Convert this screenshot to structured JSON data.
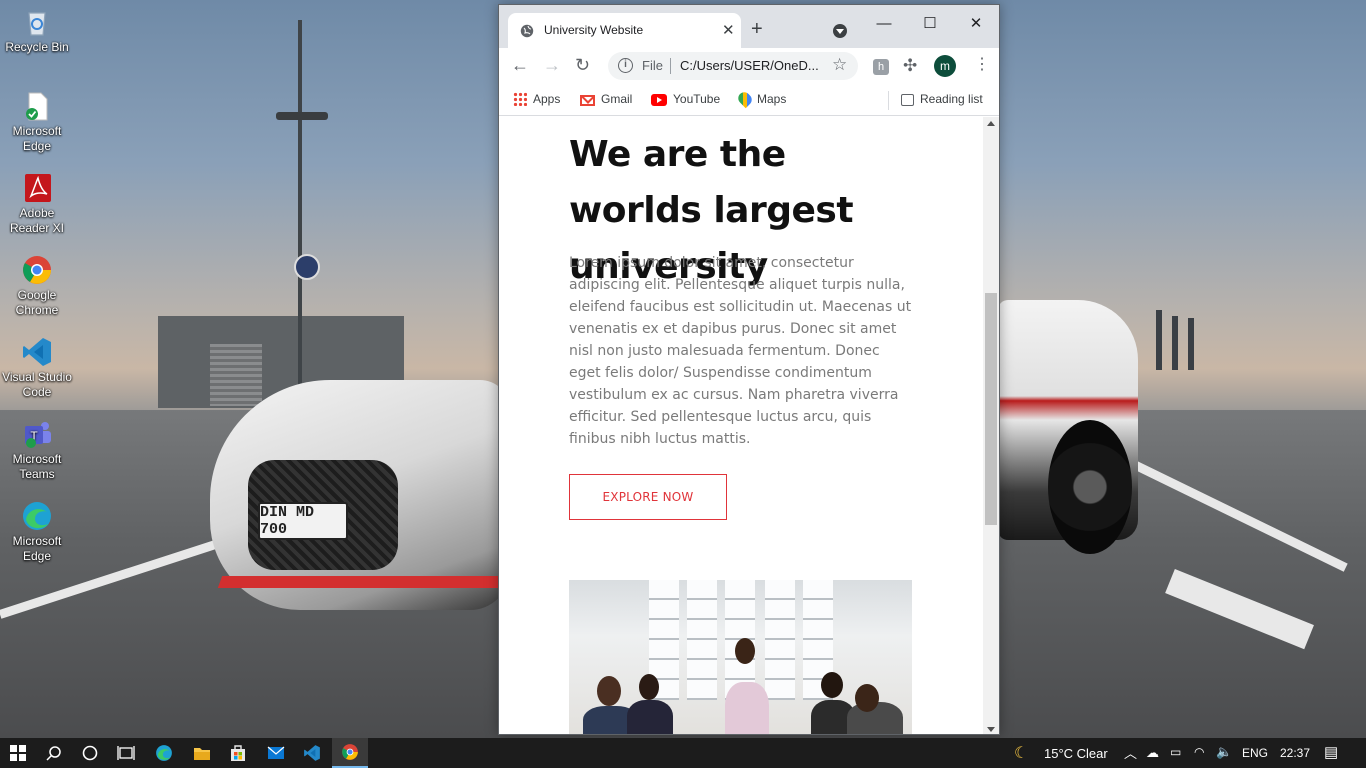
{
  "desktop": {
    "icons": [
      {
        "label": "Recycle Bin",
        "icon": "recycle-bin-icon"
      },
      {
        "label": "Microsoft Edge",
        "icon": "edge-shortcut-icon"
      },
      {
        "label": "Adobe Reader XI",
        "icon": "adobe-reader-icon"
      },
      {
        "label": "Google Chrome",
        "icon": "chrome-icon"
      },
      {
        "label": "Visual Studio Code",
        "icon": "vscode-icon"
      },
      {
        "label": "Microsoft Teams",
        "icon": "teams-icon"
      },
      {
        "label": "Microsoft Edge",
        "icon": "edge-icon"
      }
    ],
    "wallpaper_plate": "DIN MD 700"
  },
  "browser": {
    "tab_title": "University Website",
    "tab_close": "✕",
    "new_tab": "+",
    "window_controls": {
      "minimize": "—",
      "maximize": "☐",
      "close": "✕"
    },
    "address": {
      "scheme_label": "File",
      "url": "C:/Users/USER/OneD..."
    },
    "profile_initial": "m",
    "bookmarks": [
      {
        "label": "Apps",
        "icon": "apps-grid-icon"
      },
      {
        "label": "Gmail",
        "icon": "gmail-icon"
      },
      {
        "label": "YouTube",
        "icon": "youtube-icon"
      },
      {
        "label": "Maps",
        "icon": "maps-icon"
      }
    ],
    "reading_list": "Reading list"
  },
  "page": {
    "hero_title": "We are the worlds largest university",
    "hero_text": "Lorem ipsum dolor sit amet, consectetur adipiscing elit. Pellentesque aliquet turpis nulla, eleifend faucibus est sollicitudin ut. Maecenas ut venenatis ex et dapibus purus. Donec sit amet nisl non justo malesuada fermentum. Donec eget felis dolor/ Suspendisse condimentum vestibulum ex ac cursus. Nam pharetra viverra efficitur. Sed pellentesque luctus arcu, quis finibus nibh luctus mattis.",
    "cta_label": "EXPLORE NOW",
    "accent_color": "#e0343a"
  },
  "taskbar": {
    "weather": "15°C  Clear",
    "language": "ENG",
    "time": "22:37"
  }
}
